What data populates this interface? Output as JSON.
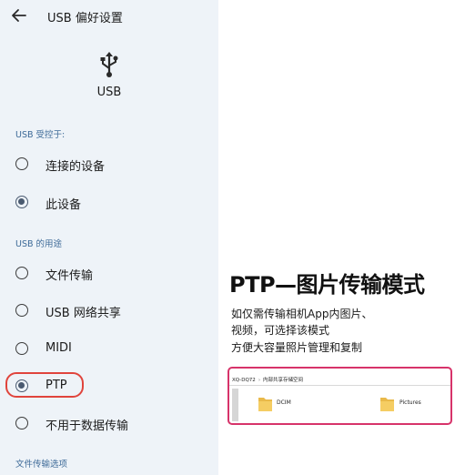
{
  "settings": {
    "title": "USB 偏好设置",
    "device_label": "USB",
    "section_controlled_by": "USB 受控于:",
    "controlled_options": [
      {
        "label": "连接的设备",
        "selected": false
      },
      {
        "label": "此设备",
        "selected": true
      }
    ],
    "section_use_for": "USB 的用途",
    "use_options": [
      {
        "label": "文件传输",
        "selected": false
      },
      {
        "label": "USB 网络共享",
        "selected": false
      },
      {
        "label": "MIDI",
        "selected": false
      },
      {
        "label": "PTP",
        "selected": true
      },
      {
        "label": "不用于数据传输",
        "selected": false
      }
    ],
    "section_file_transfer": "文件传输选项",
    "accent_color": "#3d6a98",
    "highlight_color": "#e0443c"
  },
  "info": {
    "headline": "PTP—图片传输模式",
    "lines": [
      "如仅需传输相机App内图片、",
      "视频，可选择该模式",
      "方便大容量照片管理和复制"
    ]
  },
  "explorer": {
    "path": [
      "XQ-DQ72",
      "内部共享存储空间"
    ],
    "folders": [
      "DCIM",
      "Pictures"
    ],
    "border_color": "#d7336a"
  }
}
